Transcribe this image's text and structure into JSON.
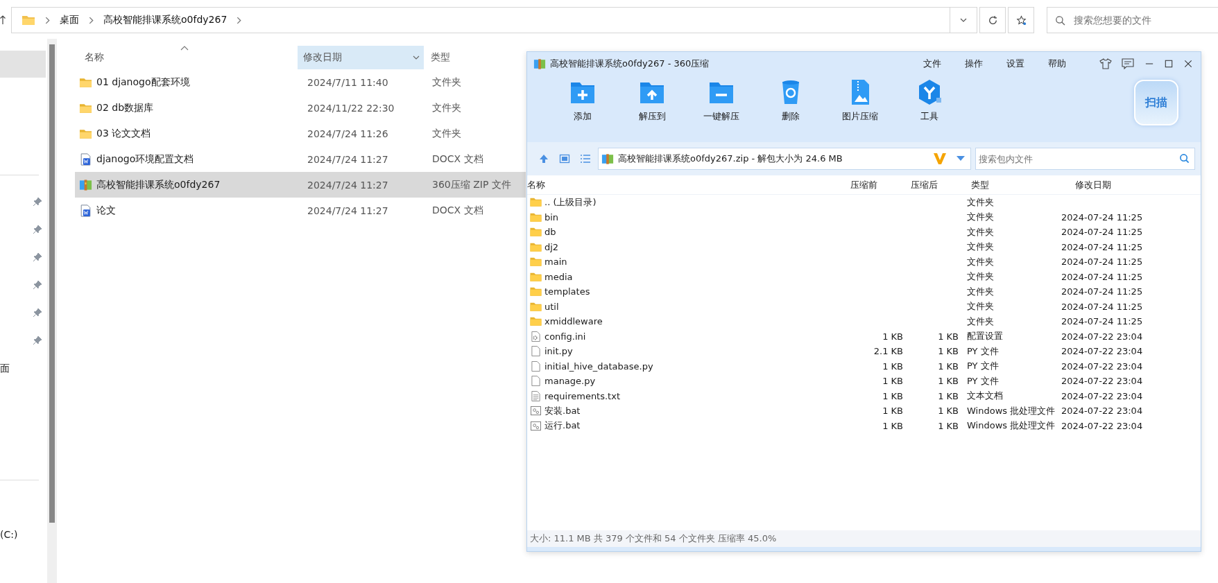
{
  "address_bar": {
    "breadcrumbs": [
      "桌面",
      "高校智能排课系统o0fdy267"
    ]
  },
  "search": {
    "placeholder": "搜索您想要的文件"
  },
  "sidebar": {
    "items": [
      {
        "label": "面"
      },
      {
        "label": "(C:)"
      }
    ]
  },
  "explorer": {
    "columns": [
      {
        "label": "名称",
        "selected": false
      },
      {
        "label": "修改日期",
        "selected": true
      },
      {
        "label": "类型",
        "selected": false
      }
    ],
    "rows": [
      {
        "name": "01 djanogo配套环境",
        "date": "2024/7/11 11:40",
        "type": "文件夹",
        "kind": "folder",
        "selected": false
      },
      {
        "name": "02 db数据库",
        "date": "2024/11/22 22:30",
        "type": "文件夹",
        "kind": "folder",
        "selected": false
      },
      {
        "name": "03 论文文档",
        "date": "2024/7/24 11:26",
        "type": "文件夹",
        "kind": "folder",
        "selected": false
      },
      {
        "name": "djanogo环境配置文档",
        "date": "2024/7/24 11:27",
        "type": "DOCX 文档",
        "kind": "word",
        "selected": false
      },
      {
        "name": "高校智能排课系统o0fdy267",
        "date": "2024/7/24 11:27",
        "type": "360压缩 ZIP 文件",
        "kind": "zip",
        "selected": true
      },
      {
        "name": "论文",
        "date": "2024/7/24 11:27",
        "type": "DOCX 文档",
        "kind": "word",
        "selected": false
      }
    ]
  },
  "archive_window": {
    "title": "高校智能排课系统o0fdy267 - 360压缩",
    "menu": [
      "文件",
      "操作",
      "设置",
      "帮助"
    ],
    "toolbar": [
      {
        "label": "添加",
        "kind": "add"
      },
      {
        "label": "解压到",
        "kind": "extract"
      },
      {
        "label": "一键解压",
        "kind": "quick"
      },
      {
        "label": "删除",
        "kind": "delete"
      },
      {
        "label": "图片压缩",
        "kind": "image"
      },
      {
        "label": "工具",
        "kind": "tools"
      }
    ],
    "scan_badge": "扫描",
    "path": "高校智能排课系统o0fdy267.zip - 解包大小为 24.6 MB",
    "search": {
      "placeholder": "搜索包内文件"
    },
    "columns": [
      "名称",
      "压缩前",
      "压缩后",
      "类型",
      "修改日期"
    ],
    "rows": [
      {
        "kind": "folder",
        "name": ".. (上级目录)",
        "before": "",
        "after": "",
        "type": "文件夹",
        "date": ""
      },
      {
        "kind": "folder",
        "name": "bin",
        "before": "",
        "after": "",
        "type": "文件夹",
        "date": "2024-07-24 11:25"
      },
      {
        "kind": "folder",
        "name": "db",
        "before": "",
        "after": "",
        "type": "文件夹",
        "date": "2024-07-24 11:25"
      },
      {
        "kind": "folder",
        "name": "dj2",
        "before": "",
        "after": "",
        "type": "文件夹",
        "date": "2024-07-24 11:25"
      },
      {
        "kind": "folder",
        "name": "main",
        "before": "",
        "after": "",
        "type": "文件夹",
        "date": "2024-07-24 11:25"
      },
      {
        "kind": "folder",
        "name": "media",
        "before": "",
        "after": "",
        "type": "文件夹",
        "date": "2024-07-24 11:25"
      },
      {
        "kind": "folder",
        "name": "templates",
        "before": "",
        "after": "",
        "type": "文件夹",
        "date": "2024-07-24 11:25"
      },
      {
        "kind": "folder",
        "name": "util",
        "before": "",
        "after": "",
        "type": "文件夹",
        "date": "2024-07-24 11:25"
      },
      {
        "kind": "folder",
        "name": "xmiddleware",
        "before": "",
        "after": "",
        "type": "文件夹",
        "date": "2024-07-24 11:25"
      },
      {
        "kind": "config",
        "name": "config.ini",
        "before": "1 KB",
        "after": "1 KB",
        "type": "配置设置",
        "date": "2024-07-22 23:04"
      },
      {
        "kind": "file",
        "name": "init.py",
        "before": "2.1 KB",
        "after": "1 KB",
        "type": "PY 文件",
        "date": "2024-07-22 23:04"
      },
      {
        "kind": "file",
        "name": "initial_hive_database.py",
        "before": "1 KB",
        "after": "1 KB",
        "type": "PY 文件",
        "date": "2024-07-22 23:04"
      },
      {
        "kind": "file",
        "name": "manage.py",
        "before": "1 KB",
        "after": "1 KB",
        "type": "PY 文件",
        "date": "2024-07-22 23:04"
      },
      {
        "kind": "text",
        "name": "requirements.txt",
        "before": "1 KB",
        "after": "1 KB",
        "type": "文本文档",
        "date": "2024-07-22 23:04"
      },
      {
        "kind": "bat",
        "name": "安装.bat",
        "before": "1 KB",
        "after": "1 KB",
        "type": "Windows 批处理文件",
        "date": "2024-07-22 23:04"
      },
      {
        "kind": "bat",
        "name": "运行.bat",
        "before": "1 KB",
        "after": "1 KB",
        "type": "Windows 批处理文件",
        "date": "2024-07-22 23:04"
      }
    ],
    "status": "大小: 11.1 MB 共 379 个文件和 54 个文件夹 压缩率 45.0%"
  }
}
